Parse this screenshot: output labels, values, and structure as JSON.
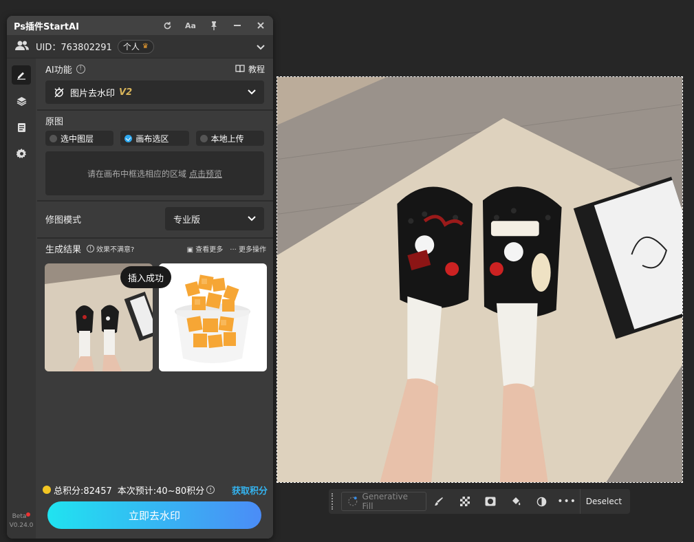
{
  "plugin": {
    "title": "Ps插件StartAI",
    "uid_text": "UID：763802291",
    "account_tag": "个人",
    "ai_section_label": "AI功能",
    "tutorial_label": "教程",
    "feature_name": "图片去水印",
    "feature_version": "V2",
    "source_label": "原图",
    "source_options": [
      "选中图层",
      "画布选区",
      "本地上传"
    ],
    "source_selected": "画布选区",
    "canvas_hint": "请在画布中框选相应的区域",
    "preview_link": "点击预览",
    "mode_label": "修图模式",
    "mode_value": "专业版",
    "results_label": "生成结果",
    "feedback_label": "效果不满意?",
    "view_more_label": "查看更多",
    "more_actions_label": "更多操作",
    "toast_text": "插入成功",
    "total_points": "总积分:82457",
    "estimate_points": "本次预计:40~80积分",
    "get_points_label": "获取积分",
    "action_button_label": "立即去水印",
    "beta_label": "Beta",
    "version_label": "V0.24.0"
  },
  "context_bar": {
    "generative_fill_label": "Generative Fill",
    "deselect_label": "Deselect"
  },
  "colors": {
    "accent_blue": "#34b4f0",
    "button_gradient_start": "#20e3f0",
    "button_gradient_end": "#4b8cf6",
    "v2_gold": "#d8b45a"
  }
}
